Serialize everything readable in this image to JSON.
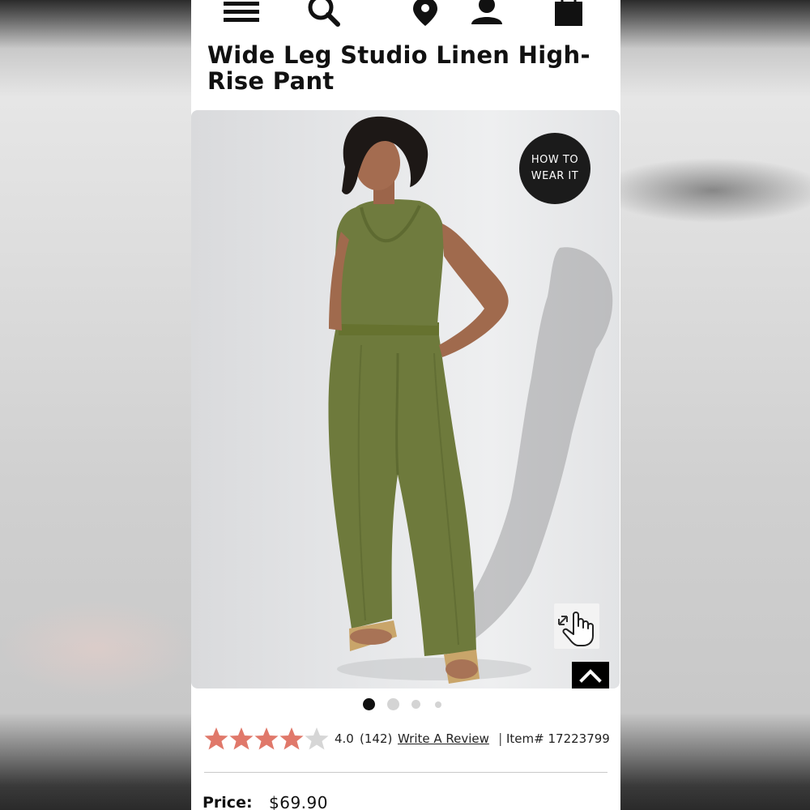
{
  "nav": {
    "icons": [
      "menu-icon",
      "search-icon",
      "location-pin-icon",
      "account-icon",
      "shopping-bag-icon"
    ]
  },
  "product": {
    "title": "Wide Leg Studio Linen High-Rise Pant",
    "image_badge": {
      "line1": "HOW TO",
      "line2": "WEAR IT"
    },
    "image_count": 4,
    "active_image": 1,
    "colors": {
      "star": "#e0786a",
      "star_empty": "#d6d6d6",
      "accent": "#111111",
      "fabric": "#6f7b3e"
    }
  },
  "rating": {
    "stars_filled": 4.0,
    "stars_total": 5,
    "value": "4.0",
    "count": "(142)",
    "write_review": "Write A Review",
    "separator": "|",
    "item_label": "Item# 17223799"
  },
  "price": {
    "label": "Price:",
    "value": "$69.90"
  }
}
